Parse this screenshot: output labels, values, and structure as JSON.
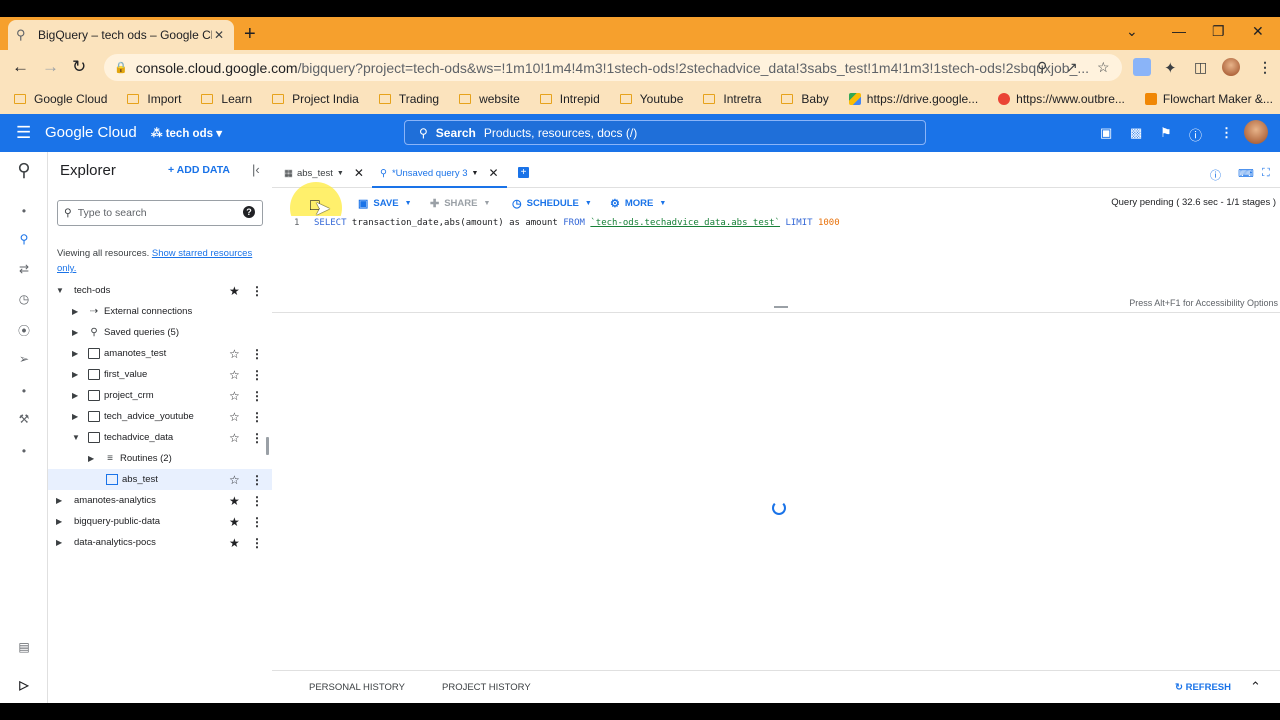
{
  "browser": {
    "tab_title": "BigQuery – tech ods – Google Cl",
    "url_host": "console.cloud.google.com",
    "url_path": "/bigquery?project=tech-ods&ws=!1m10!1m4!4m3!1stech-ods!2stechadvice_data!3sabs_test!1m4!1m3!1stech-ods!2sbquxjob_..."
  },
  "bookmarks": [
    {
      "label": "Google Cloud",
      "type": "folder"
    },
    {
      "label": "Import",
      "type": "folder"
    },
    {
      "label": "Learn",
      "type": "folder"
    },
    {
      "label": "Project India",
      "type": "folder"
    },
    {
      "label": "Trading",
      "type": "folder"
    },
    {
      "label": "website",
      "type": "folder"
    },
    {
      "label": "Intrepid",
      "type": "folder"
    },
    {
      "label": "Youtube",
      "type": "folder"
    },
    {
      "label": "Intretra",
      "type": "folder"
    },
    {
      "label": "Baby",
      "type": "folder"
    },
    {
      "label": "https://drive.google...",
      "type": "drive"
    },
    {
      "label": "https://www.outbre...",
      "type": "outbrain"
    },
    {
      "label": "Flowchart Maker &...",
      "type": "drawio"
    }
  ],
  "header": {
    "logo": "Google Cloud",
    "project": "tech ods",
    "search_bold": "Search",
    "search_placeholder": "Products, resources, docs (/)"
  },
  "explorer": {
    "title": "Explorer",
    "add_data": "ADD DATA",
    "search_placeholder": "Type to search",
    "info_text": "Viewing all resources.",
    "info_link": "Show starred resources only.",
    "tree": [
      {
        "label": "tech-ods",
        "level": 0,
        "expanded": true,
        "icon": "none",
        "star": "filled"
      },
      {
        "label": "External connections",
        "level": 1,
        "expanded": false,
        "icon": "connection",
        "star": "none"
      },
      {
        "label": "Saved queries (5)",
        "level": 1,
        "expanded": false,
        "icon": "query",
        "star": "none"
      },
      {
        "label": "amanotes_test",
        "level": 1,
        "expanded": false,
        "icon": "dataset",
        "star": "outline"
      },
      {
        "label": "first_value",
        "level": 1,
        "expanded": false,
        "icon": "dataset",
        "star": "outline"
      },
      {
        "label": "project_crm",
        "level": 1,
        "expanded": false,
        "icon": "dataset",
        "star": "outline"
      },
      {
        "label": "tech_advice_youtube",
        "level": 1,
        "expanded": false,
        "icon": "dataset",
        "star": "outline"
      },
      {
        "label": "techadvice_data",
        "level": 1,
        "expanded": true,
        "icon": "dataset",
        "star": "outline"
      },
      {
        "label": "Routines (2)",
        "level": 2,
        "expanded": false,
        "icon": "routine",
        "star": "none"
      },
      {
        "label": "abs_test",
        "level": 2,
        "expanded": null,
        "icon": "table",
        "star": "outline",
        "selected": true
      },
      {
        "label": "amanotes-analytics",
        "level": 0,
        "expanded": false,
        "icon": "none",
        "star": "filled"
      },
      {
        "label": "bigquery-public-data",
        "level": 0,
        "expanded": false,
        "icon": "none",
        "star": "filled"
      },
      {
        "label": "data-analytics-pocs",
        "level": 0,
        "expanded": false,
        "icon": "none",
        "star": "filled"
      }
    ]
  },
  "editor": {
    "tabs": [
      {
        "label": "abs_test",
        "active": false
      },
      {
        "label": "*Unsaved query 3",
        "active": true
      }
    ],
    "toolbar": {
      "save": "SAVE",
      "share": "SHARE",
      "schedule": "SCHEDULE",
      "more": "MORE"
    },
    "status": "Query pending ( 32.6 sec - 1/1 stages )",
    "line_number": "1",
    "sql": {
      "kw_select": "SELECT",
      "cols": " transaction_date,abs(amount) as amount ",
      "kw_from": "FROM",
      "table": "`tech-ods.techadvice_data.abs_test`",
      "kw_limit": "LIMIT",
      "limit_value": "1000"
    },
    "a11y_hint": "Press Alt+F1 for Accessibility Options"
  },
  "footer": {
    "personal_history": "PERSONAL HISTORY",
    "project_history": "PROJECT HISTORY",
    "refresh": "REFRESH"
  },
  "colors": {
    "accent": "#1a73e8",
    "chrome_frame": "#f6a02d",
    "chrome_toolbar": "#fbe3bd"
  }
}
